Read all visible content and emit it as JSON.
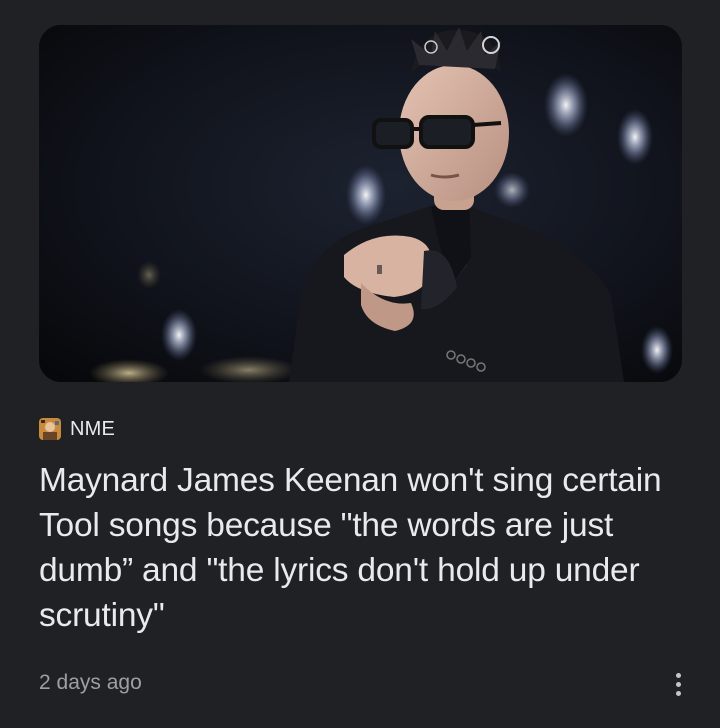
{
  "article": {
    "image_description": "Photo of a man in a dark suit with glasses and a spiked mohawk, hands clasped, on a dark stage with bokeh lights",
    "source": {
      "name": "NME",
      "favicon_icon": "publisher-logo-icon"
    },
    "headline": "Maynard James Keenan won't sing certain Tool songs because \"the words are just dumb” and \"the lyrics don't hold up under scrutiny\"",
    "timestamp": "2 days ago",
    "more_icon": "more-vert-icon"
  },
  "colors": {
    "background": "#202124",
    "headline_text": "#e8eaed",
    "secondary_text": "#9aa0a6"
  }
}
